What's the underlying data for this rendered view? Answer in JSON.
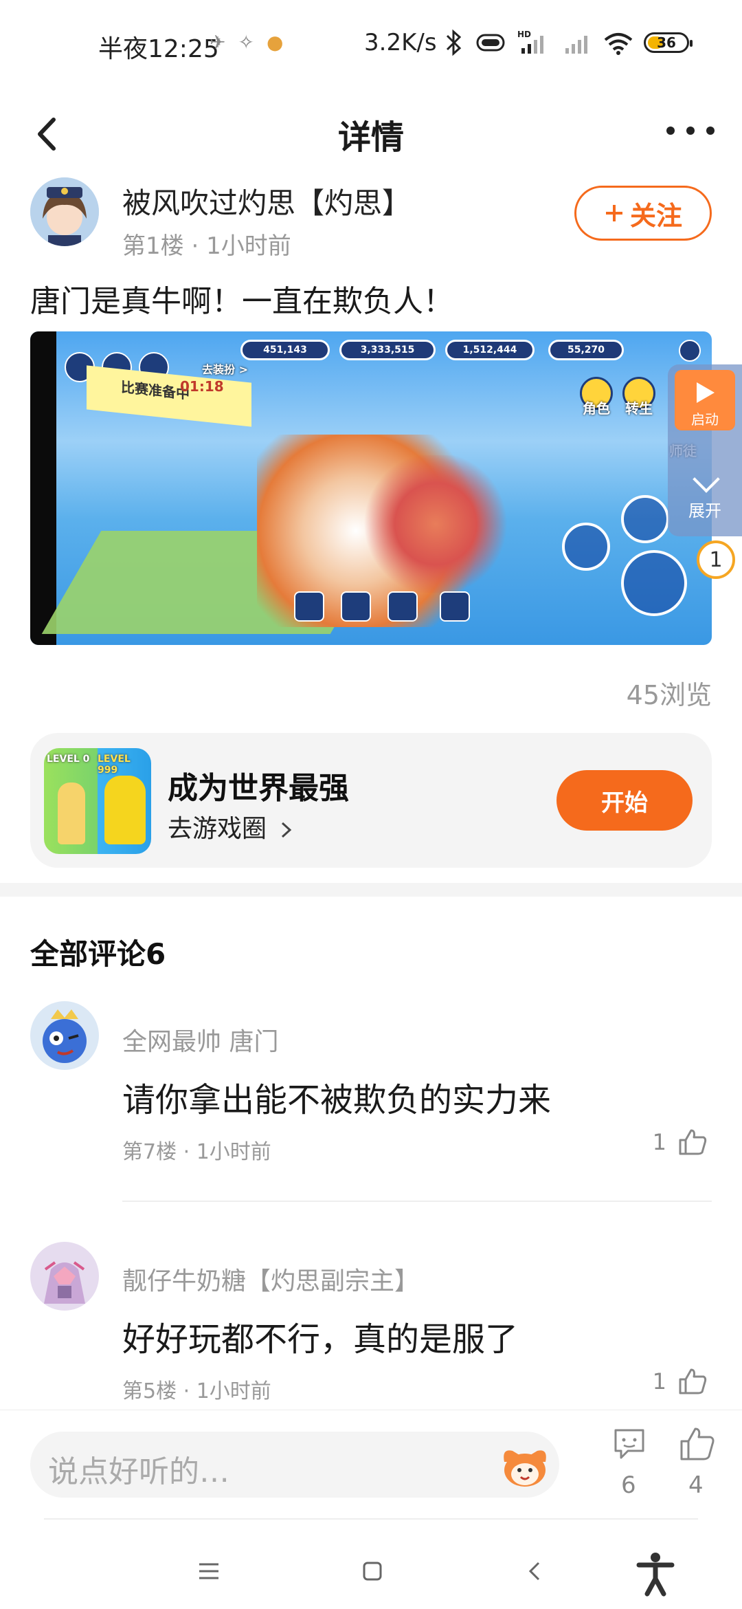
{
  "status_bar": {
    "time": "半夜12:25",
    "net_speed": "3.2K/s",
    "battery": "36"
  },
  "header": {
    "title": "详情"
  },
  "post": {
    "author_name": "被风吹过灼思【灼思】",
    "floor": "第1楼",
    "time": "1小时前",
    "follow_label": "关注",
    "text": "唐门是真牛啊！一直在欺负人！",
    "views": "45浏览"
  },
  "media": {
    "stats": [
      "451,143",
      "3,333,515",
      "1,512,444",
      "55,270"
    ],
    "banner": "比赛准备中",
    "timer": "01:18",
    "outfit_label": "去装扮 >",
    "role_label": "角色",
    "rebirth_label": "转生",
    "master_label": "师徒"
  },
  "float_widget": {
    "launch_label": "启动",
    "expand_label": "展开",
    "badge": "1"
  },
  "game_card": {
    "title": "成为世界最强",
    "link_label": "去游戏圈",
    "start_label": "开始",
    "thumb_left": "LEVEL 0",
    "thumb_right": "LEVEL 999"
  },
  "comments": {
    "title": "全部评论6",
    "items": [
      {
        "name": "全网最帅 唐门",
        "text": "请你拿出能不被欺负的实力来",
        "floor": "第7楼",
        "time": "1小时前",
        "likes": "1"
      },
      {
        "name": "靓仔牛奶糖【灼思副宗主】",
        "text": "好好玩都不行，真的是服了",
        "floor": "第5楼",
        "time": "1小时前",
        "likes": "1"
      }
    ]
  },
  "bottom_bar": {
    "placeholder": "说点好听的…",
    "comment_count": "6",
    "like_count": "4"
  },
  "colors": {
    "accent": "#f56a1c",
    "muted": "#999999"
  }
}
